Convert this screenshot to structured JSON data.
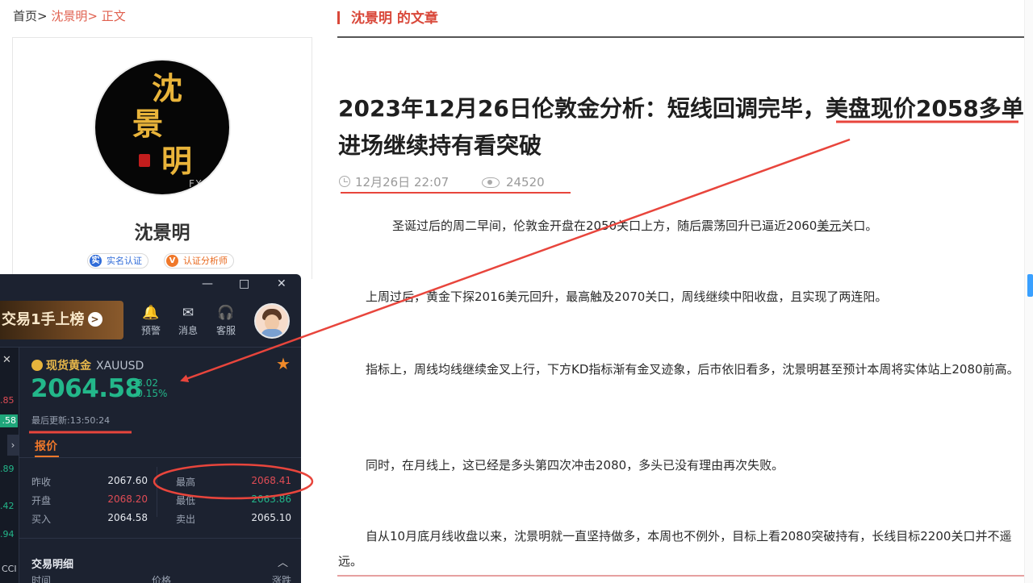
{
  "breadcrumb": {
    "home": "首页>",
    "author": "沈景明>",
    "current": "正文"
  },
  "section": {
    "title": "沈景明 的文章"
  },
  "profile": {
    "avatar_chars": [
      "沈",
      "景",
      "明"
    ],
    "avatar_mark": "FXA",
    "name": "沈景明",
    "badge_real": "实名认证",
    "badge_real_icon": "实",
    "badge_analyst": "认证分析师",
    "badge_analyst_icon": "V"
  },
  "article": {
    "title": "2023年12月26日伦敦金分析：短线回调完毕，美盘现价2058多单进场继续持有看突破",
    "date": "12月26日 22:07",
    "views": "24520",
    "paragraphs": [
      {
        "before": "圣诞过后的周二早间，伦敦金开盘在2050关口上方，随后震荡回升已逼近2060",
        "link": "美元",
        "after": "关口。"
      },
      {
        "text": "上周过后，黄金下探2016美元回升，最高触及2070关口，周线继续中阳收盘，且实现了两连阳。"
      },
      {
        "text": "指标上，周线均线继续金叉上行，下方KD指标渐有金叉迹象，后市依旧看多，沈景明甚至预计本周将实体站上2080前高。"
      },
      {
        "text": "同时，在月线上，这已经是多头第四次冲击2080，多头已没有理由再次失败。"
      },
      {
        "text": "自从10月底月线收盘以来，沈景明就一直坚持做多，本周也不例外，目标上看2080突破持有，长线目标2200关口并不遥远。"
      }
    ]
  },
  "app": {
    "window_buttons": {
      "minimize": "—",
      "maximize": "□",
      "close": "✕"
    },
    "promo": "交易1手上榜",
    "tools": [
      {
        "icon": "bell-icon",
        "glyph": "🔔",
        "label": "预警"
      },
      {
        "icon": "mail-icon",
        "glyph": "✉",
        "label": "消息"
      },
      {
        "icon": "headset-icon",
        "glyph": "🎧",
        "label": "客服"
      }
    ],
    "left_strip_values": [
      ".85",
      ".58",
      ".89",
      ".42",
      ".94",
      "CCI"
    ],
    "symbol_cn": "现货黄金",
    "symbol_code": "XAUUSD",
    "price": "2064.58",
    "change": "-3.02",
    "change_pct": "-0.15%",
    "last_update": "最后更新:13:50:24",
    "tab": "报价",
    "rows": [
      {
        "l1": "昨收",
        "v1": "2067.60",
        "c1": "white",
        "l2": "最高",
        "v2": "2068.41",
        "c2": "red"
      },
      {
        "l1": "开盘",
        "v1": "2068.20",
        "c1": "red",
        "l2": "最低",
        "v2": "2063.86",
        "c2": "green"
      },
      {
        "l1": "买入",
        "v1": "2064.58",
        "c1": "white",
        "l2": "卖出",
        "v2": "2065.10",
        "c2": "white"
      }
    ],
    "details_title": "交易明细",
    "details_cols": [
      "时间",
      "价格",
      "涨跌"
    ]
  },
  "colors": {
    "accent_red": "#d9483a",
    "price_green": "#23b78a",
    "gold": "#e9b84a",
    "annotation": "#e8453c"
  }
}
